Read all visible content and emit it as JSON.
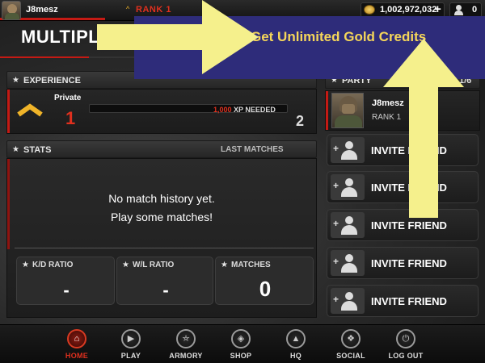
{
  "topbar": {
    "username": "J8mesz",
    "rank_label": "RANK 1",
    "gold_amount": "1,002,972,032",
    "gold_plus": "+",
    "friends_count": "0"
  },
  "page": {
    "title": "MULTIPLAY"
  },
  "promo": {
    "text": "Get Unlimited Gold Credits",
    "background_color": "#2e2c7a",
    "text_color": "#f5d65a",
    "arrow_color": "#f5f08c"
  },
  "experience": {
    "heading": "EXPERIENCE",
    "rank_name": "Private",
    "current_rank": "1",
    "xp_needed_number": "1,000",
    "xp_needed_text": "XP NEEDED",
    "next_rank": "2",
    "progress": 0
  },
  "stats": {
    "heading": "STATS",
    "last_matches": "LAST MATCHES",
    "empty_line1": "No match history yet.",
    "empty_line2": "Play some matches!",
    "cards": [
      {
        "label": "K/D RATIO",
        "value": "-"
      },
      {
        "label": "W/L RATIO",
        "value": "-"
      },
      {
        "label": "MATCHES",
        "value": "0"
      }
    ]
  },
  "party": {
    "heading": "PARTY",
    "count": "1/6",
    "member_name": "J8mesz",
    "member_rank": "RANK 1",
    "invite_label": "INVITE FRIEND",
    "invite_slots": 5
  },
  "nav": {
    "items": [
      {
        "label": "HOME",
        "icon": "home-icon",
        "active": true
      },
      {
        "label": "PLAY",
        "icon": "play-icon",
        "active": false
      },
      {
        "label": "ARMORY",
        "icon": "armory-icon",
        "active": false
      },
      {
        "label": "SHOP",
        "icon": "shop-icon",
        "active": false
      },
      {
        "label": "HQ",
        "icon": "hq-icon",
        "active": false
      },
      {
        "label": "SOCIAL",
        "icon": "social-icon",
        "active": false
      },
      {
        "label": "LOG OUT",
        "icon": "power-icon",
        "active": false
      }
    ]
  },
  "colors": {
    "accent_red": "#c41a14",
    "rank_red": "#e0301e",
    "rank_chevron": "#f0b429"
  }
}
